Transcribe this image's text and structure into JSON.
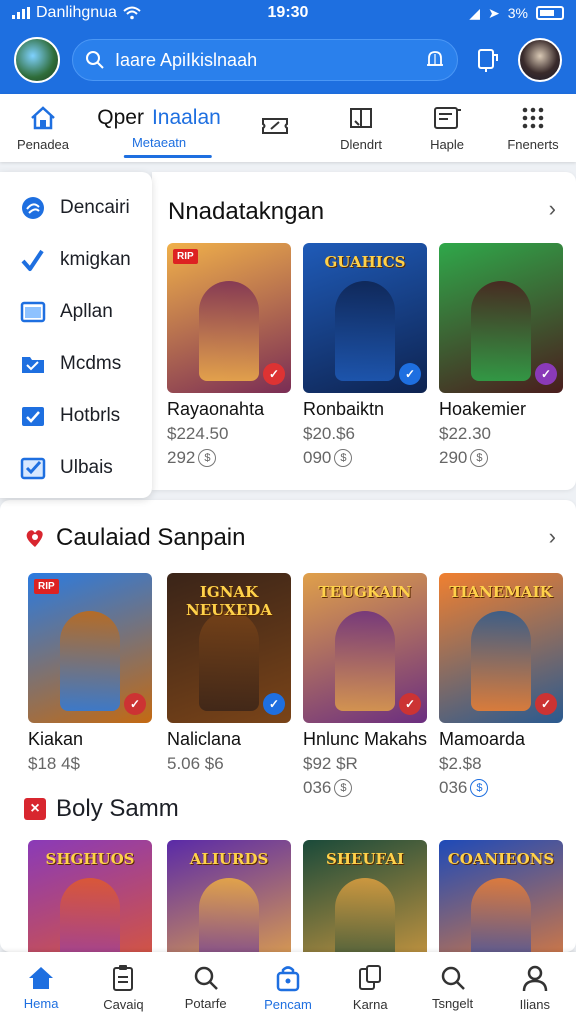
{
  "status": {
    "carrier": "Danlihgnua",
    "time": "19:30",
    "battery_text": "3%"
  },
  "header": {
    "search_placeholder": "Iaare ApiIkislnaah"
  },
  "tabs": [
    {
      "label": "Penadea",
      "icon": "home-icon"
    },
    {
      "title_a": "Qper",
      "title_b": "Inaalan",
      "label": "Metaeatn",
      "active": true
    },
    {
      "label": "",
      "icon": "ticket-icon"
    },
    {
      "label": "Dlendrt",
      "icon": "book-icon"
    },
    {
      "label": "Haple",
      "icon": "note-icon"
    },
    {
      "label": "Fnenerts",
      "icon": "grid-icon"
    }
  ],
  "sidebar": {
    "items": [
      {
        "label": "Dencairi",
        "icon": "swirl-icon"
      },
      {
        "label": "kmigkan",
        "icon": "music-icon"
      },
      {
        "label": "Apllan",
        "icon": "window-icon"
      },
      {
        "label": "Mcdms",
        "icon": "folder-icon"
      },
      {
        "label": "Hotbrls",
        "icon": "check-folder-icon"
      },
      {
        "label": "Ulbais",
        "icon": "check-box-icon"
      }
    ]
  },
  "section1": {
    "title": "Nnadatakngan",
    "games": [
      {
        "name": "Rayaonahta",
        "price": "$224.50",
        "count": "292",
        "art_title": "",
        "tag": "RIP",
        "badge_color": "#d33",
        "bg": [
          "#f0b04a",
          "#7a2d55"
        ]
      },
      {
        "name": "Ronbaiktn",
        "price": "$20.$6",
        "count": "090",
        "art_title": "GUAHICS",
        "tag": "",
        "badge_color": "#1e6fe0",
        "bg": [
          "#1f5bb8",
          "#0e2350"
        ]
      },
      {
        "name": "Hoakemier",
        "price": "$22.30",
        "count": "290",
        "art_title": "",
        "tag": "",
        "badge_color": "#8a3ab8",
        "bg": [
          "#2fa84a",
          "#4a1d1d"
        ]
      }
    ]
  },
  "section2": {
    "title": "Caulaiad Sanpain",
    "games": [
      {
        "name": "Kiakan",
        "price": "$18 4$",
        "count": "",
        "art_title": "",
        "tag": "RIP",
        "badge_color": "#c33",
        "bg": [
          "#2b7be0",
          "#c46a12"
        ]
      },
      {
        "name": "Naliclana",
        "price": "5.06 $6",
        "count": "",
        "art_title": "IGNAK NEUXEDA",
        "tag": "",
        "badge_color": "#1e6fe0",
        "bg": [
          "#3a2418",
          "#7a4418"
        ]
      },
      {
        "name": "Hnlunc Makahs",
        "price": "$92 $R",
        "count": "036",
        "art_title": "TEUGKAIN",
        "tag": "",
        "badge_color": "#c33",
        "bg": [
          "#e0a04a",
          "#6b2e80"
        ]
      },
      {
        "name": "Mamoarda",
        "price": "$2.$8",
        "count": "036",
        "art_title": "TIANEMAIK",
        "tag": "",
        "badge_color": "#c33",
        "bg": [
          "#f08030",
          "#2a5a90"
        ]
      }
    ]
  },
  "section3": {
    "title": "Boly Samm",
    "games": [
      {
        "art_title": "SHGHUOS",
        "bg": [
          "#8a3ab8",
          "#e25a2a"
        ]
      },
      {
        "art_title": "ALIURDS",
        "bg": [
          "#5a2aa8",
          "#f0b040"
        ]
      },
      {
        "art_title": "SHEUFAI",
        "bg": [
          "#1a4a3a",
          "#e0a040"
        ]
      },
      {
        "art_title": "COANIEONS",
        "bg": [
          "#1e4ab8",
          "#f08030"
        ]
      }
    ]
  },
  "bottom_nav": [
    {
      "label": "Hema",
      "icon": "home-icon",
      "active": true
    },
    {
      "label": "Cavaiq",
      "icon": "clipboard-icon"
    },
    {
      "label": "Potarfe",
      "icon": "search-icon"
    },
    {
      "label": "Pencam",
      "icon": "bag-icon"
    },
    {
      "label": "Karna",
      "icon": "cards-icon"
    },
    {
      "label": "Tsngelt",
      "icon": "search-icon"
    },
    {
      "label": "Ilians",
      "icon": "person-icon"
    }
  ],
  "colors": {
    "brand": "#1e6fe0",
    "accent_red": "#d8262f"
  }
}
